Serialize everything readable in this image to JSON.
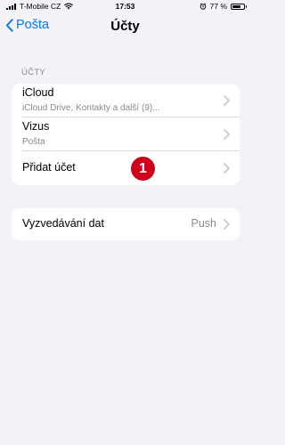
{
  "status_bar": {
    "carrier": "T-Mobile CZ",
    "time": "17:53",
    "battery_text": "77 %",
    "battery_level": 0.77,
    "icons": [
      "signal-icon",
      "wifi-icon",
      "alarm-icon",
      "battery-icon"
    ]
  },
  "nav": {
    "back_label": "Pošta",
    "title": "Účty"
  },
  "accounts": {
    "header": "ÚČTY",
    "items": [
      {
        "title": "iCloud",
        "subtitle": "iCloud Drive, Kontakty a další (9)..."
      },
      {
        "title": "Vizus",
        "subtitle": "Pošta"
      },
      {
        "title": "Přidat účet"
      }
    ]
  },
  "fetch": {
    "label": "Vyzvedávání dat",
    "value": "Push"
  },
  "callout": {
    "number": "1",
    "color": "#d0021b"
  },
  "colors": {
    "accent": "#007aff",
    "background": "#f2f2f7",
    "secondary_text": "#8a8a8e"
  }
}
